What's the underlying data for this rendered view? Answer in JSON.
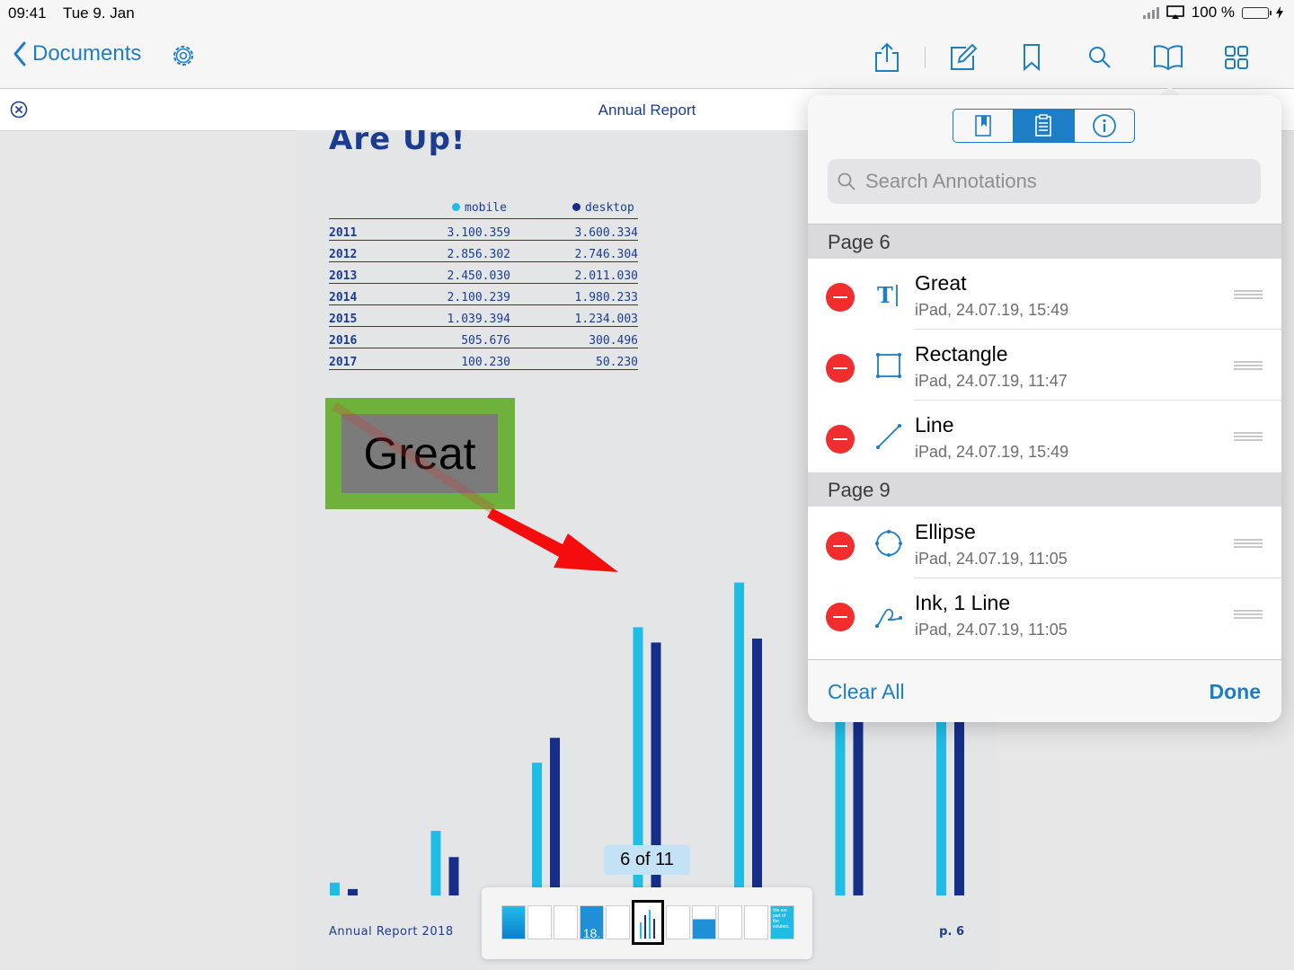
{
  "status": {
    "time": "09:41",
    "date": "Tue 9. Jan",
    "battery": "100 %"
  },
  "nav": {
    "back_label": "Documents"
  },
  "doc": {
    "title": "Annual Report"
  },
  "page": {
    "heading": "Are Up!",
    "footer_left": "Annual Report 2018",
    "footer_right": "p. 6",
    "legend": {
      "mobile": "mobile",
      "desktop": "desktop"
    },
    "colors": {
      "mobile": "#1fbde6",
      "desktop": "#152e8a"
    },
    "table": [
      {
        "year": "2011",
        "mobile": "3.100.359",
        "desktop": "3.600.334"
      },
      {
        "year": "2012",
        "mobile": "2.856.302",
        "desktop": "2.746.304"
      },
      {
        "year": "2013",
        "mobile": "2.450.030",
        "desktop": "2.011.030"
      },
      {
        "year": "2014",
        "mobile": "2.100.239",
        "desktop": "1.980.233"
      },
      {
        "year": "2015",
        "mobile": "1.039.394",
        "desktop": "1.234.003"
      },
      {
        "year": "2016",
        "mobile": "505.676",
        "desktop": "300.496"
      },
      {
        "year": "2017",
        "mobile": "100.230",
        "desktop": "50.230"
      }
    ]
  },
  "annotation_text": "Great",
  "page_counter": "6 of 11",
  "thumbnail_texts": {
    "page4": "18.",
    "page11": "We are part of the solution."
  },
  "popover": {
    "search_placeholder": "Search Annotations",
    "sections": [
      {
        "title": "Page 6",
        "items": [
          {
            "title": "Great",
            "subtitle": "iPad, 24.07.19, 15:49",
            "icon": "text-icon"
          },
          {
            "title": "Rectangle",
            "subtitle": "iPad, 24.07.19, 11:47",
            "icon": "rectangle-icon"
          },
          {
            "title": "Line",
            "subtitle": "iPad, 24.07.19, 15:49",
            "icon": "line-icon"
          }
        ]
      },
      {
        "title": "Page 9",
        "items": [
          {
            "title": "Ellipse",
            "subtitle": "iPad, 24.07.19, 11:05",
            "icon": "ellipse-icon"
          },
          {
            "title": "Ink, 1 Line",
            "subtitle": "iPad, 24.07.19, 11:05",
            "icon": "ink-icon"
          }
        ]
      }
    ],
    "clear_all": "Clear All",
    "done": "Done"
  },
  "chart_data": {
    "type": "bar",
    "categories": [
      "2011",
      "2012",
      "2013",
      "2014",
      "2015",
      "2016",
      "2017"
    ],
    "series": [
      {
        "name": "mobile",
        "values": [
          100230,
          505676,
          1039394,
          2100239,
          2450030,
          2856302,
          3100359
        ]
      },
      {
        "name": "desktop",
        "values": [
          50230,
          300496,
          1234003,
          1980233,
          2011030,
          2746304,
          3600334
        ]
      }
    ],
    "title": "",
    "xlabel": "",
    "ylabel": "",
    "ylim": [
      0,
      3600334
    ],
    "legend": "top-right"
  }
}
